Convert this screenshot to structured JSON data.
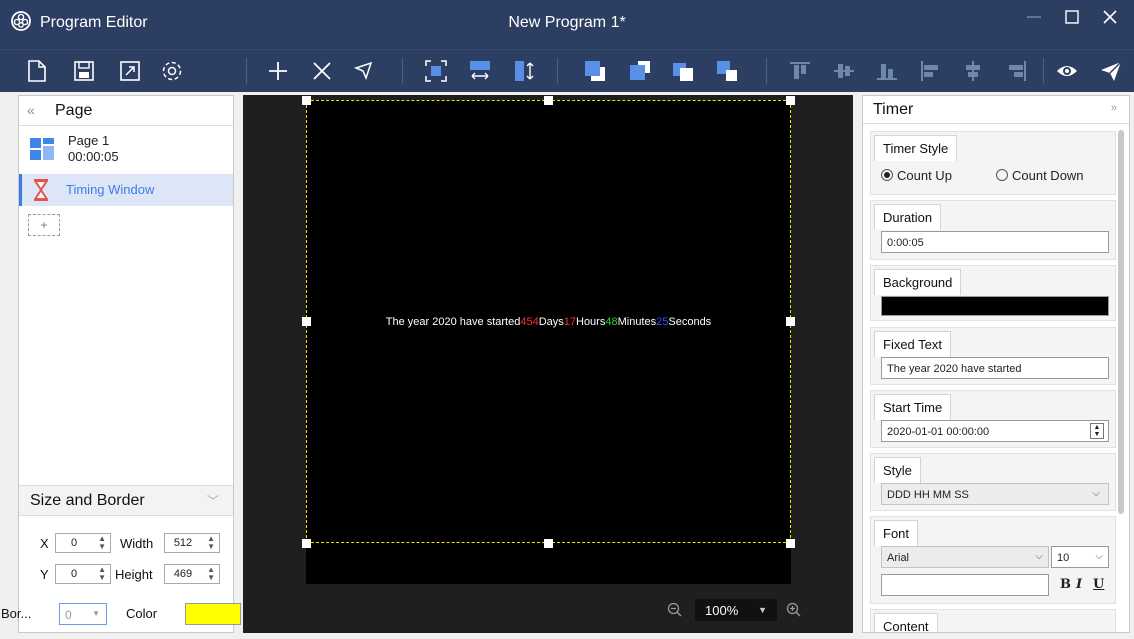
{
  "window": {
    "app_title": "Program Editor",
    "doc_title": "New Program 1*"
  },
  "toolbar": {
    "icons": [
      "new-file-icon",
      "save-icon",
      "expand-icon",
      "settings-icon",
      "add-icon",
      "delete-icon",
      "select-icon",
      "fit-screen-icon",
      "horizontal-fit-icon",
      "vertical-fit-icon",
      "bring-to-front-icon",
      "bring-forward-icon",
      "send-backward-icon",
      "send-to-back-icon",
      "align-top-icon",
      "align-vcenter-icon",
      "align-bottom-icon",
      "align-left-icon",
      "align-hcenter-icon",
      "align-right-icon",
      "preview-icon",
      "send-icon"
    ]
  },
  "page_panel": {
    "collapse": "«",
    "title": "Page",
    "page": {
      "name": "Page 1",
      "duration": "00:00:05"
    },
    "item": {
      "name": "Timing Window"
    },
    "add_label": "+"
  },
  "size_border": {
    "title": "Size and Border",
    "x_label": "X",
    "x_value": "0",
    "y_label": "Y",
    "y_value": "0",
    "width_label": "Width",
    "width_value": "512",
    "height_label": "Height",
    "height_value": "469",
    "border_label": "Bor...",
    "border_value": "0",
    "color_label": "Color",
    "color_value": "#ffff00"
  },
  "canvas": {
    "text": {
      "fixed": "The year 2020 have started",
      "days": "454",
      "days_label": "Days",
      "hours": "17",
      "hours_label": "Hours",
      "minutes": "48",
      "minutes_label": "Minutes",
      "seconds": "25",
      "seconds_label": "Seconds"
    },
    "colors": {
      "days": "#ff2a2a",
      "hours": "#ff2a2a",
      "minutes": "#2fd02f",
      "seconds": "#3050ff"
    },
    "zoom": "100%"
  },
  "timer_panel": {
    "title": "Timer",
    "collapse": "»",
    "timer_style": {
      "label": "Timer Style",
      "count_up": "Count Up",
      "count_down": "Count Down",
      "selected": "Count Up"
    },
    "duration": {
      "label": "Duration",
      "value": "0:00:05"
    },
    "background": {
      "label": "Background",
      "value": "#000000"
    },
    "fixed_text": {
      "label": "Fixed Text",
      "value": "The year 2020 have started"
    },
    "start_time": {
      "label": "Start Time",
      "value": "2020-01-01 00:00:00"
    },
    "style": {
      "label": "Style",
      "value": "DDD HH MM SS"
    },
    "font": {
      "label": "Font",
      "family": "Arial",
      "size": "10",
      "bold": "B",
      "italic": "I",
      "underline": "U"
    },
    "content": {
      "label": "Content"
    }
  }
}
